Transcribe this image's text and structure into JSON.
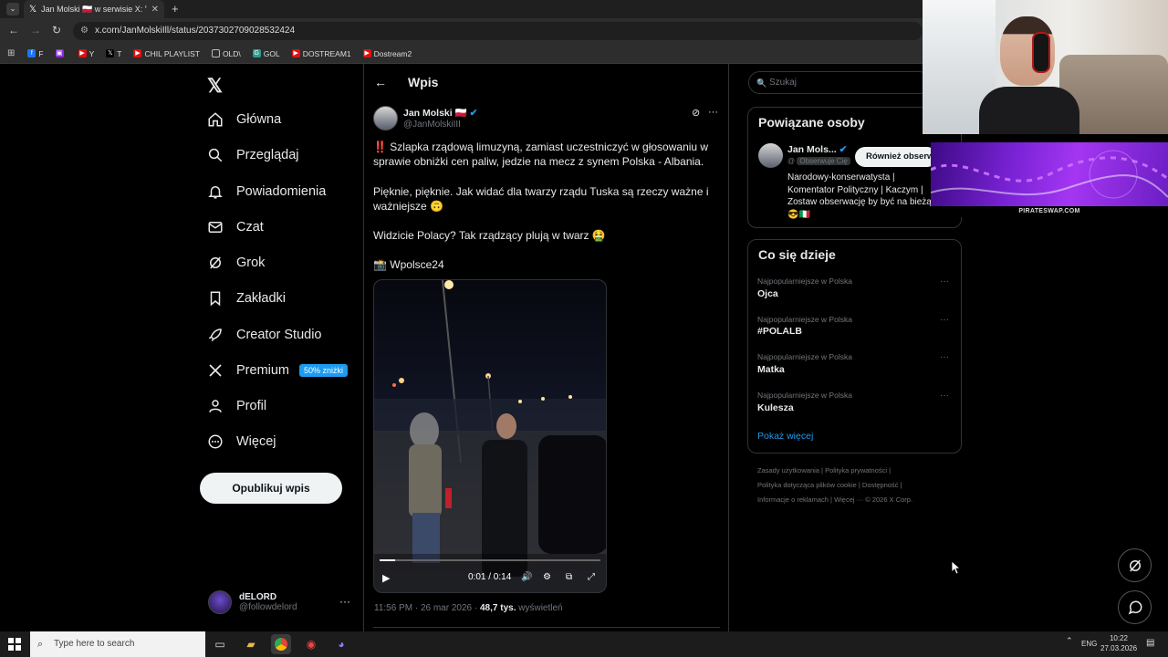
{
  "browser": {
    "tab_title": "Jan Molski 🇵🇱 w serwisie X: \"",
    "url": "x.com/JanMolskiIll/status/2037302709028532424",
    "bookmarks": [
      {
        "label": "F",
        "color": "#1877f2"
      },
      {
        "label": "",
        "color": "#8a2be2"
      },
      {
        "label": "Y",
        "color": "#e01010"
      },
      {
        "label": "T",
        "color": "#000000"
      },
      {
        "label": "CHIL PLAYLIST",
        "color": "#e01010"
      },
      {
        "label": "OLD\\",
        "color": "#666666"
      },
      {
        "label": "GOL",
        "color": "#2a9d8f"
      },
      {
        "label": "DOSTREAM1",
        "color": "#e01010"
      },
      {
        "label": "Dostream2",
        "color": "#e01010"
      }
    ]
  },
  "nav": {
    "items": [
      {
        "label": "Główna",
        "icon": "home-icon"
      },
      {
        "label": "Przeglądaj",
        "icon": "search-icon"
      },
      {
        "label": "Powiadomienia",
        "icon": "bell-icon"
      },
      {
        "label": "Czat",
        "icon": "mail-icon"
      },
      {
        "label": "Grok",
        "icon": "grok-icon"
      },
      {
        "label": "Zakładki",
        "icon": "bookmark-icon"
      },
      {
        "label": "Creator Studio",
        "icon": "rocket-icon"
      },
      {
        "label": "Premium",
        "icon": "x-icon"
      },
      {
        "label": "Profil",
        "icon": "person-icon"
      },
      {
        "label": "Więcej",
        "icon": "more-circle-icon"
      }
    ],
    "premium_badge": "50% zniżki",
    "post_button": "Opublikuj wpis",
    "account_name": "dELORD",
    "account_handle": "@followdelord"
  },
  "post": {
    "header": "Wpis",
    "author_name": "Jan Molski 🇵🇱",
    "author_handle": "@JanMolskiIII",
    "p1": "‼️ Szlapka rządową limuzyną, zamiast uczestniczyć w głosowaniu w sprawie obniżki cen paliw, jedzie na mecz z synem Polska - Albania.",
    "p2": "Pięknie, pięknie. Jak widać dla twarzy rządu Tuska są rzeczy ważne i ważniejsze 🙃",
    "p3": "Widzicie Polacy? Tak rządzący plują w twarz 🤮",
    "p4": "📸 Wpolsce24",
    "video_time": "0:01 / 0:14",
    "video_progress": 0.07,
    "time": "11:56 PM · 26 mar 2026",
    "views": "48,7 tys.",
    "views_label": "wyświetleń"
  },
  "right": {
    "search_placeholder": "Szukaj",
    "related_title": "Powiązane osoby",
    "related_name": "Jan Mols...",
    "related_follows": "Obserwuje Cię",
    "related_button": "Również obserwuj",
    "related_bio": "Narodowy-konserwatysta | Komentator Polityczny | Kaczym | Zostaw obserwację by być na bieżą 😎🇮🇹",
    "trends_title": "Co się dzieje",
    "trends": [
      {
        "category": "Najpopularniejsze w Polska",
        "name": "Ojca"
      },
      {
        "category": "Najpopularniejsze w Polska",
        "name": "#POLALB"
      },
      {
        "category": "Najpopularniejsze w Polska",
        "name": "Matka"
      },
      {
        "category": "Najpopularniejsze w Polska",
        "name": "Kulesza"
      }
    ],
    "show_more": "Pokaż więcej",
    "footer_line1": "Zasady użytkowania  |  Polityka prywatności  |",
    "footer_line2": "Polityka dotycząca plików cookie  |  Dostępność  |",
    "footer_line3": "Informacje o reklamach  |  Więcej ···  © 2026 X Corp."
  },
  "overlay": {
    "promo_label": "PIRATESWAP.COM"
  },
  "taskbar": {
    "search_placeholder": "Type here to search",
    "lang": "ENG",
    "time": "10:22",
    "date": "27.03.2026"
  }
}
